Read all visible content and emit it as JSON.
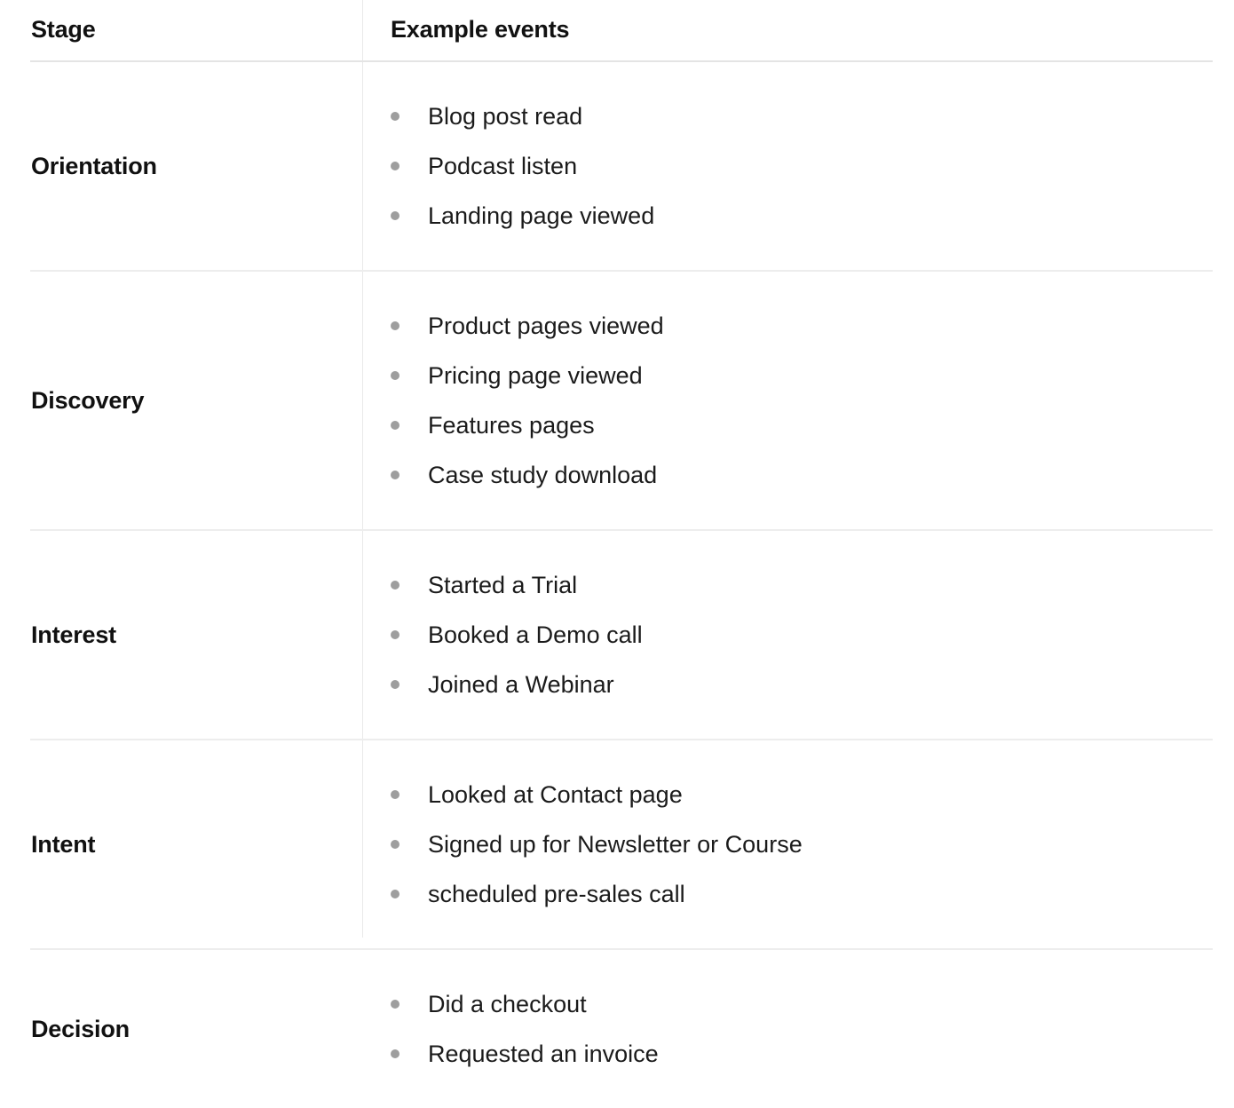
{
  "table": {
    "columns": [
      {
        "key": "stage",
        "label": "Stage"
      },
      {
        "key": "events",
        "label": "Example events"
      }
    ],
    "bullet_color": "#9e9e9e",
    "border_color": "#ededed",
    "header_border_color": "#e4e4e4",
    "divider_color": "#e9e9e9",
    "text_color": "#1b1b1b",
    "heading_color": "#111111",
    "background": "#ffffff",
    "rows": [
      {
        "stage": "Orientation",
        "events": [
          "Blog post read",
          "Podcast listen",
          "Landing page viewed"
        ]
      },
      {
        "stage": "Discovery",
        "events": [
          "Product pages viewed",
          "Pricing page viewed",
          "Features pages",
          "Case study download"
        ]
      },
      {
        "stage": "Interest",
        "events": [
          "Started a Trial",
          "Booked a Demo call",
          "Joined a Webinar"
        ]
      },
      {
        "stage": "Intent",
        "events": [
          "Looked at Contact page",
          "Signed up for Newsletter or Course",
          "scheduled pre-sales call"
        ]
      },
      {
        "stage": "Decision",
        "events": [
          "Did a checkout",
          "Requested an invoice"
        ]
      }
    ]
  }
}
